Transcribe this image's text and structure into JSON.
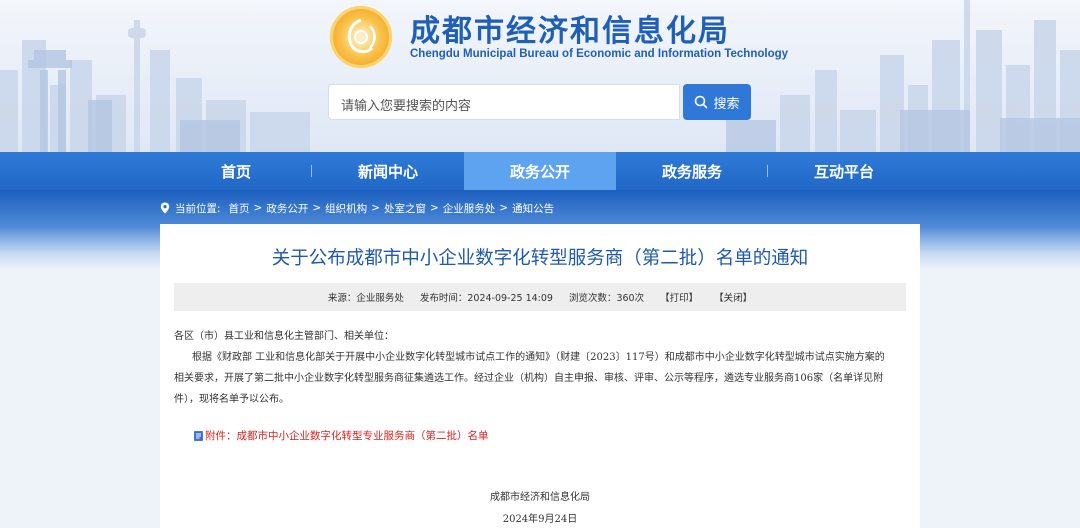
{
  "header": {
    "title": "成都市经济和信息化局",
    "subtitle": "Chengdu Municipal Bureau of Economic and Information Technology",
    "colors": {
      "brand": "#1f5fb8",
      "accent": "#2f78d8"
    }
  },
  "search": {
    "placeholder": "请输入您要搜索的内容",
    "button_label": "搜索",
    "icon": "search-icon"
  },
  "nav": {
    "items": [
      "首页",
      "新闻中心",
      "政务公开",
      "政务服务",
      "互动平台"
    ],
    "active": "政务公开"
  },
  "breadcrumb": {
    "icon": "location-pin-icon",
    "label": "当前位置:",
    "items": [
      "首页",
      "政务公开",
      "组织机构",
      "处室之窗",
      "企业服务处",
      "通知公告"
    ]
  },
  "article": {
    "title": "关于公布成都市中小企业数字化转型服务商（第二批）名单的通知",
    "meta": {
      "source": "来源：企业服务处",
      "published": "发布时间：2024-09-25 14:09",
      "views": "浏览次数：360次",
      "print": "【打印】",
      "close": "【关闭】"
    },
    "salutation": "各区（市）县工业和信息化主管部门、相关单位：",
    "body": "根据《财政部 工业和信息化部关于开展中小企业数字化转型城市试点工作的通知》（财建〔2023〕117号）和成都市中小企业数字化转型城市试点实施方案的相关要求，开展了第二批中小企业数字化转型服务商征集遴选工作。经过企业（机构）自主申报、审核、评审、公示等程序，遴选专业服务商106家（名单详见附件），现将名单予以公布。",
    "attachment": "附件：成都市中小企业数字化转型专业服务商（第二批）名单",
    "signature_org": "成都市经济和信息化局",
    "signature_date": "2024年9月24日"
  }
}
